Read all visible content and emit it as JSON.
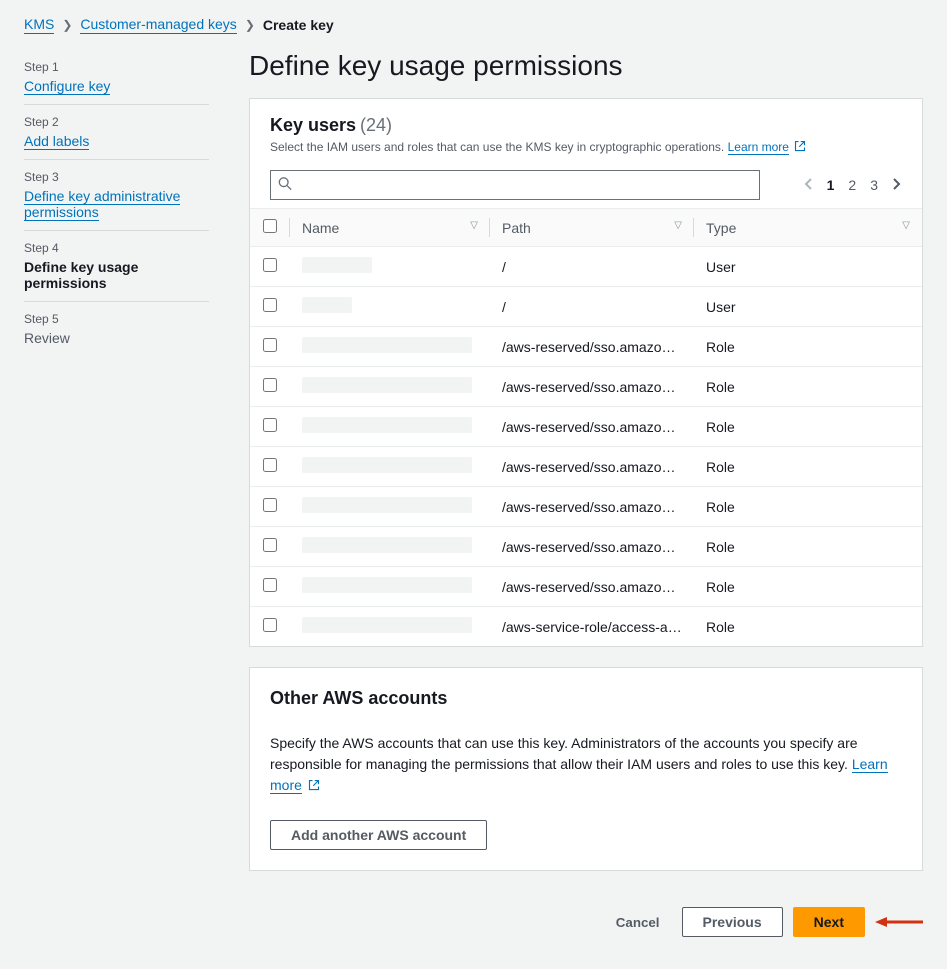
{
  "breadcrumb": {
    "items": [
      "KMS",
      "Customer-managed keys",
      "Create key"
    ]
  },
  "sidebar": {
    "steps": [
      {
        "label": "Step 1",
        "title": "Configure key",
        "type": "link"
      },
      {
        "label": "Step 2",
        "title": "Add labels",
        "type": "link"
      },
      {
        "label": "Step 3",
        "title": "Define key administrative permissions",
        "type": "link"
      },
      {
        "label": "Step 4",
        "title": "Define key usage permissions",
        "type": "current"
      },
      {
        "label": "Step 5",
        "title": "Review",
        "type": "plain"
      }
    ]
  },
  "heading": "Define key usage permissions",
  "keyUsers": {
    "title": "Key users",
    "count": "(24)",
    "description": "Select the IAM users and roles that can use the KMS key in cryptographic operations.",
    "learnMore": "Learn more",
    "searchPlaceholder": "",
    "columns": {
      "name": "Name",
      "path": "Path",
      "type": "Type"
    },
    "pagination": {
      "pages": [
        "1",
        "2",
        "3"
      ],
      "active": 0
    },
    "rows": [
      {
        "nameWidth": 70,
        "path": "/",
        "type": "User"
      },
      {
        "nameWidth": 50,
        "path": "/",
        "type": "User"
      },
      {
        "nameWidth": 170,
        "path": "/aws-reserved/sso.amazonaws…",
        "type": "Role"
      },
      {
        "nameWidth": 170,
        "path": "/aws-reserved/sso.amazonaws…",
        "type": "Role"
      },
      {
        "nameWidth": 170,
        "path": "/aws-reserved/sso.amazonaws…",
        "type": "Role"
      },
      {
        "nameWidth": 170,
        "path": "/aws-reserved/sso.amazonaws…",
        "type": "Role"
      },
      {
        "nameWidth": 170,
        "path": "/aws-reserved/sso.amazonaws…",
        "type": "Role"
      },
      {
        "nameWidth": 170,
        "path": "/aws-reserved/sso.amazonaws…",
        "type": "Role"
      },
      {
        "nameWidth": 170,
        "path": "/aws-reserved/sso.amazonaws…",
        "type": "Role"
      },
      {
        "nameWidth": 170,
        "path": "/aws-service-role/access-analy…",
        "type": "Role"
      }
    ]
  },
  "otherAccounts": {
    "title": "Other AWS accounts",
    "description": "Specify the AWS accounts that can use this key. Administrators of the accounts you specify are responsible for managing the permissions that allow their IAM users and roles to use this key.",
    "learnMore": "Learn more",
    "addButton": "Add another AWS account"
  },
  "footer": {
    "cancel": "Cancel",
    "previous": "Previous",
    "next": "Next"
  }
}
